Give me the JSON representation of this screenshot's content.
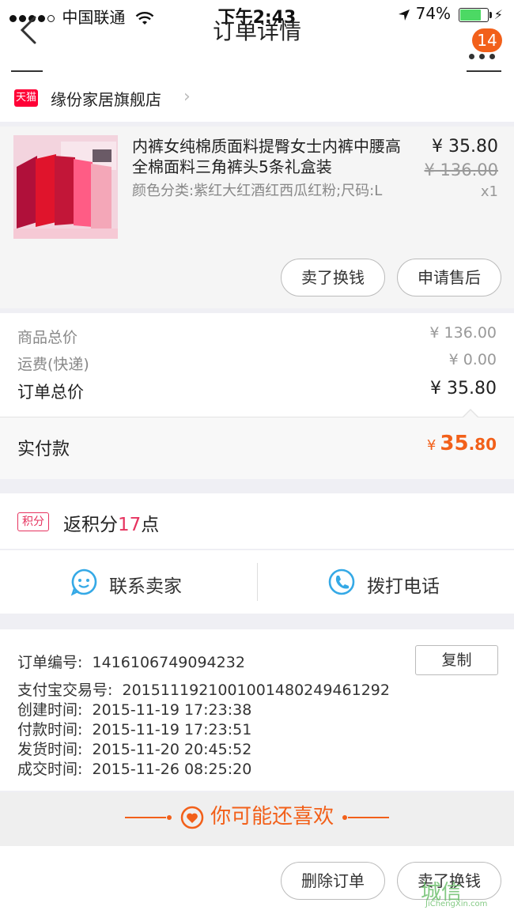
{
  "status_bar": {
    "carrier": "中国联通",
    "time": "下午2:43",
    "battery": "74%",
    "battery_level": 0.74
  },
  "nav": {
    "title": "订单详情",
    "badge": "14"
  },
  "shop": {
    "badge": "天猫",
    "name": "缘份家居旗舰店"
  },
  "product": {
    "title": "内裤女纯棉质面料提臀女士内裤中腰高全棉面料三角裤头5条礼盒装",
    "spec": "颜色分类:紫红大红酒红西瓜红粉;尺码:L",
    "price": "¥ 35.80",
    "original_price": "¥ 136.00",
    "quantity": "x1",
    "actions": [
      "卖了换钱",
      "申请售后"
    ]
  },
  "summary": {
    "rows": [
      {
        "label": "商品总价",
        "value": "¥ 136.00"
      },
      {
        "label": "运费(快递)",
        "value": "¥ 0.00"
      }
    ],
    "total_label": "订单总价",
    "total_value": "¥ 35.80",
    "paid_label": "实付款",
    "paid_currency": "¥",
    "paid_int": "35",
    "paid_dec": ".80"
  },
  "points": {
    "badge": "积分",
    "prefix": "返积分",
    "value": "17",
    "suffix": "点"
  },
  "contact": {
    "seller": "联系卖家",
    "phone": "拨打电话"
  },
  "order_info": {
    "order_no_label": "订单编号:",
    "order_no": "1416106749094232",
    "copy": "复制",
    "alipay_label": "支付宝交易号:",
    "alipay_no": "2015111921001001480249461292",
    "created_label": "创建时间:",
    "created": "2015-11-19 17:23:38",
    "paid_label": "付款时间:",
    "paid": "2015-11-19 17:23:51",
    "shipped_label": "发货时间:",
    "shipped": "2015-11-20 20:45:52",
    "done_label": "成交时间:",
    "done": "2015-11-26 08:25:20"
  },
  "recommend": {
    "text": "你可能还喜欢"
  },
  "bottom": {
    "delete": "删除订单",
    "sell": "卖了换钱"
  },
  "watermark": {
    "main": "城信",
    "sub": "JiChengXin.com"
  },
  "colors": {
    "accent": "#f2601a",
    "points": "#e6335f",
    "tmall": "#ff0036",
    "battery": "#4cd964",
    "icon_blue": "#35a9e6"
  }
}
